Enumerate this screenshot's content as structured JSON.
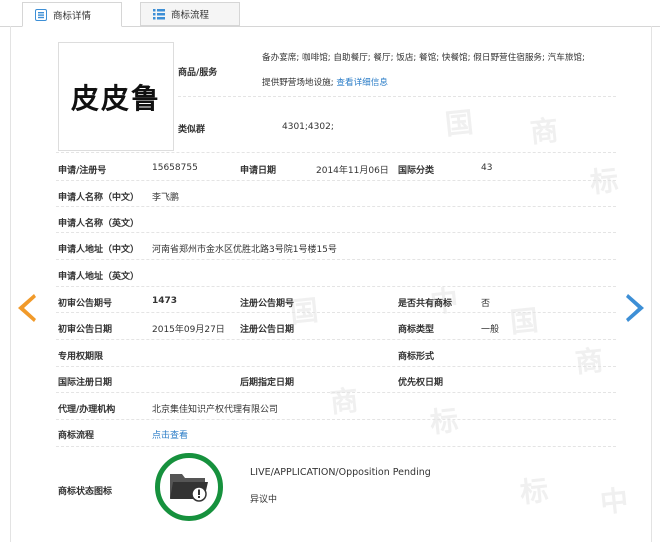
{
  "tabs": [
    {
      "label": "商标详情",
      "active": true,
      "icon": "document-icon"
    },
    {
      "label": "商标流程",
      "active": false,
      "icon": "list-icon"
    }
  ],
  "logo_text": "皮皮鲁",
  "goods": {
    "label": "商品/服务",
    "value_line1": "备办宴席; 咖啡馆; 自助餐厅; 餐厅; 饭店; 餐馆; 快餐馆; 假日野营住宿服务; 汽车旅馆;",
    "value_line2": "提供野营场地设施;",
    "link": "查看详细信息"
  },
  "similar_group": {
    "label": "类似群",
    "value": "4301;4302;"
  },
  "fields": {
    "reg_no_label": "申请/注册号",
    "reg_no": "15658755",
    "app_date_label": "申请日期",
    "app_date": "2014年11月06日",
    "intl_class_label": "国际分类",
    "intl_class": "43",
    "applicant_cn_label": "申请人名称（中文）",
    "applicant_cn": "李飞鹏",
    "applicant_en_label": "申请人名称（英文）",
    "address_cn_label": "申请人地址（中文）",
    "address_cn": "河南省郑州市金水区优胜北路3号院1号楼15号",
    "address_en_label": "申请人地址（英文）",
    "prelim_no_label": "初审公告期号",
    "prelim_no": "1473",
    "reg_pub_no_label": "注册公告期号",
    "shared_label": "是否共有商标",
    "shared": "否",
    "prelim_date_label": "初审公告日期",
    "prelim_date": "2015年09月27日",
    "reg_pub_date_label": "注册公告日期",
    "tm_type_label": "商标类型",
    "tm_type": "一般",
    "exclusive_label": "专用权期限",
    "tm_form_label": "商标形式",
    "intl_reg_date_label": "国际注册日期",
    "later_date_label": "后期指定日期",
    "priority_date_label": "优先权日期",
    "agent_label": "代理/办理机构",
    "agent": "北京集佳知识产权代理有限公司",
    "process_label": "商标流程",
    "process_link": "点击查看",
    "status_icon_label": "商标状态图标",
    "status_en": "LIVE/APPLICATION/Opposition Pending",
    "status_cn": "异议中"
  },
  "watermark_chars": [
    "中",
    "国",
    "商",
    "标"
  ],
  "colors": {
    "accent_blue": "#3d8fd6",
    "accent_orange": "#f19a2a",
    "seal_green": "#16913d",
    "link": "#2a7cc7"
  },
  "nav": {
    "prev_icon": "arrow-left-icon",
    "next_icon": "arrow-right-icon"
  }
}
